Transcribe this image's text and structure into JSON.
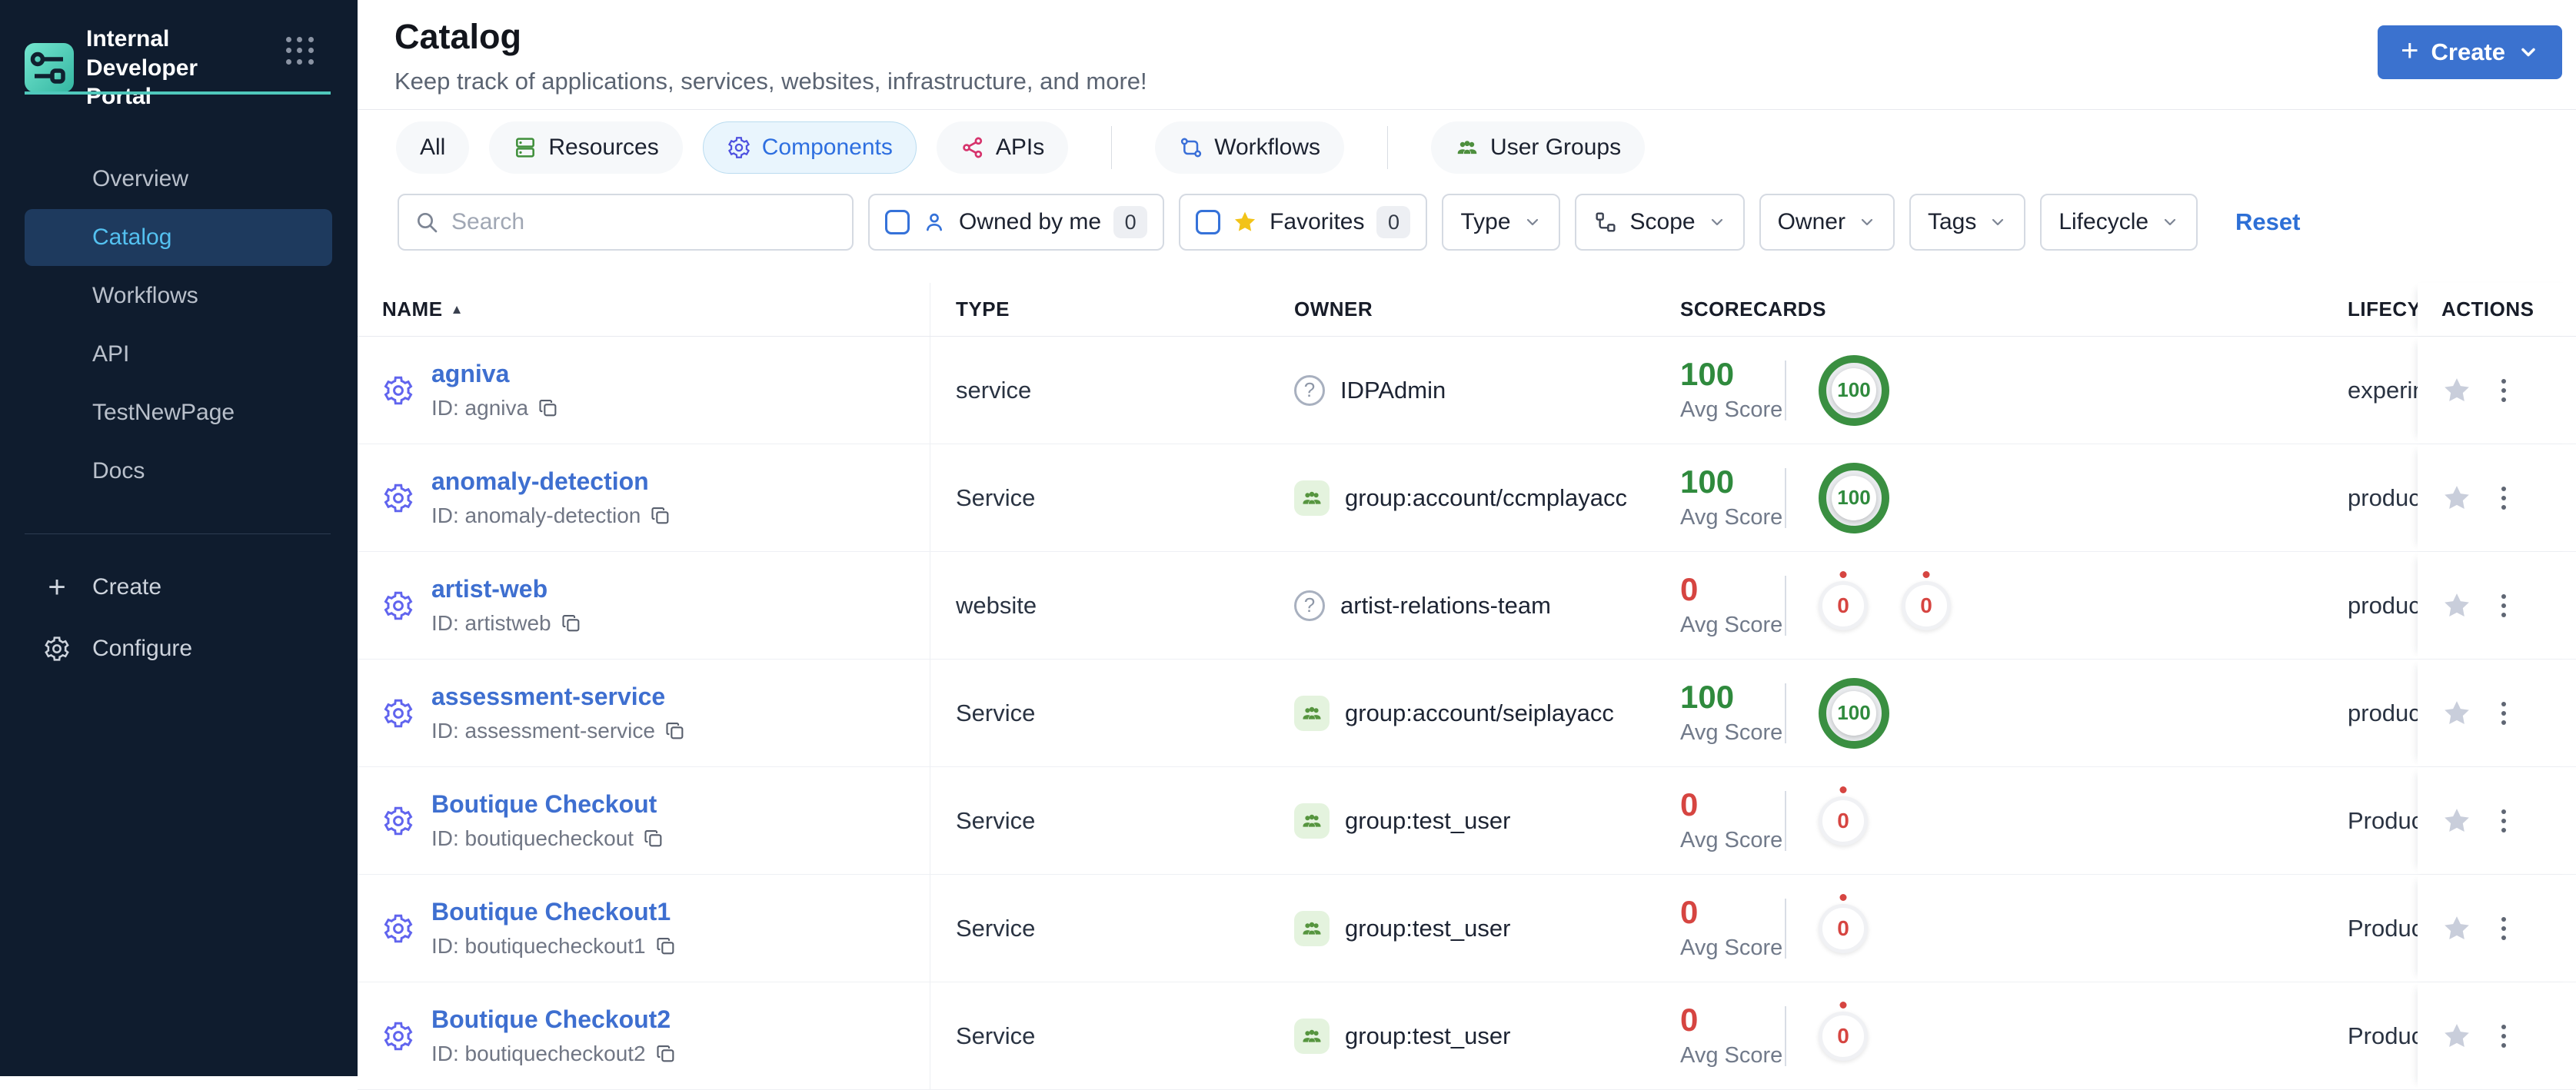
{
  "brand": {
    "name": "Internal Developer Portal"
  },
  "sidebar": {
    "nav": [
      {
        "label": "Overview",
        "active": false
      },
      {
        "label": "Catalog",
        "active": true
      },
      {
        "label": "Workflows",
        "active": false
      },
      {
        "label": "API",
        "active": false
      },
      {
        "label": "TestNewPage",
        "active": false
      },
      {
        "label": "Docs",
        "active": false
      }
    ],
    "create_label": "Create",
    "configure_label": "Configure"
  },
  "header": {
    "title": "Catalog",
    "subtitle": "Keep track of applications, services, websites, infrastructure, and more!",
    "create_button_label": "Create"
  },
  "tabs": [
    {
      "label": "All",
      "icon": "none",
      "selected": false
    },
    {
      "label": "Resources",
      "icon": "server-icon",
      "selected": false,
      "icon_color": "#3f8f3a"
    },
    {
      "label": "Components",
      "icon": "gear-icon",
      "selected": true,
      "icon_color": "#4f52e0"
    },
    {
      "label": "APIs",
      "icon": "api-icon",
      "selected": false,
      "icon_color": "#d6336c"
    },
    {
      "divider": true
    },
    {
      "label": "Workflows",
      "icon": "workflow-icon",
      "selected": false,
      "icon_color": "#3a6fd8"
    },
    {
      "divider": true
    },
    {
      "label": "User Groups",
      "icon": "users-icon",
      "selected": false,
      "icon_color": "#4e8f3e"
    }
  ],
  "filters": {
    "search_placeholder": "Search",
    "owned_by_me": {
      "label": "Owned by me",
      "count": "0"
    },
    "favorites": {
      "label": "Favorites",
      "count": "0"
    },
    "dropdowns": [
      {
        "label": "Type",
        "icon": "none"
      },
      {
        "label": "Scope",
        "icon": "scope-icon"
      },
      {
        "label": "Owner",
        "icon": "none"
      },
      {
        "label": "Tags",
        "icon": "none"
      },
      {
        "label": "Lifecycle",
        "icon": "none"
      }
    ],
    "reset_label": "Reset"
  },
  "table": {
    "headers": {
      "name": "NAME",
      "type": "TYPE",
      "owner": "OWNER",
      "scorecards": "SCORECARDS",
      "lifecycle": "LIFECYCLE",
      "actions": "ACTIONS"
    },
    "avg_score_label": "Avg Score",
    "rows": [
      {
        "name": "agniva",
        "id_label": "ID: agniva",
        "type": "service",
        "owner": "IDPAdmin",
        "owner_kind": "unknown",
        "avg_score": "100",
        "score_color": "green",
        "gauges": [
          {
            "value": "100",
            "color": "green"
          }
        ],
        "lifecycle": "experim"
      },
      {
        "name": "anomaly-detection",
        "id_label": "ID: anomaly-detection",
        "type": "Service",
        "owner": "group:account/ccmplayacc",
        "owner_kind": "group",
        "avg_score": "100",
        "score_color": "green",
        "gauges": [
          {
            "value": "100",
            "color": "green"
          }
        ],
        "lifecycle": "produc"
      },
      {
        "name": "artist-web",
        "id_label": "ID: artistweb",
        "type": "website",
        "owner": "artist-relations-team",
        "owner_kind": "unknown",
        "avg_score": "0",
        "score_color": "red",
        "gauges": [
          {
            "value": "0",
            "color": "red"
          },
          {
            "value": "0",
            "color": "red"
          }
        ],
        "lifecycle": "produc"
      },
      {
        "name": "assessment-service",
        "id_label": "ID: assessment-service",
        "type": "Service",
        "owner": "group:account/seiplayacc",
        "owner_kind": "group",
        "avg_score": "100",
        "score_color": "green",
        "gauges": [
          {
            "value": "100",
            "color": "green"
          }
        ],
        "lifecycle": "produc"
      },
      {
        "name": "Boutique Checkout",
        "id_label": "ID: boutiquecheckout",
        "type": "Service",
        "owner": "group:test_user",
        "owner_kind": "group",
        "avg_score": "0",
        "score_color": "red",
        "gauges": [
          {
            "value": "0",
            "color": "red"
          }
        ],
        "lifecycle": "Produc"
      },
      {
        "name": "Boutique Checkout1",
        "id_label": "ID: boutiquecheckout1",
        "type": "Service",
        "owner": "group:test_user",
        "owner_kind": "group",
        "avg_score": "0",
        "score_color": "red",
        "gauges": [
          {
            "value": "0",
            "color": "red"
          }
        ],
        "lifecycle": "Produc"
      },
      {
        "name": "Boutique Checkout2",
        "id_label": "ID: boutiquecheckout2",
        "type": "Service",
        "owner": "group:test_user",
        "owner_kind": "group",
        "avg_score": "0",
        "score_color": "red",
        "gauges": [
          {
            "value": "0",
            "color": "red"
          }
        ],
        "lifecycle": "Produc"
      }
    ]
  },
  "colors": {
    "sidebar_bg": "#0f1c2e",
    "sidebar_active_bg": "#1e3a5e",
    "sidebar_active_text": "#54c1f0",
    "accent_teal": "#4fc8bb",
    "primary_blue": "#3b72cf",
    "link_blue": "#3e6fd0",
    "score_green": "#2f8a3d",
    "score_red": "#d64541",
    "selected_tab_bg": "#e9f5fd"
  }
}
